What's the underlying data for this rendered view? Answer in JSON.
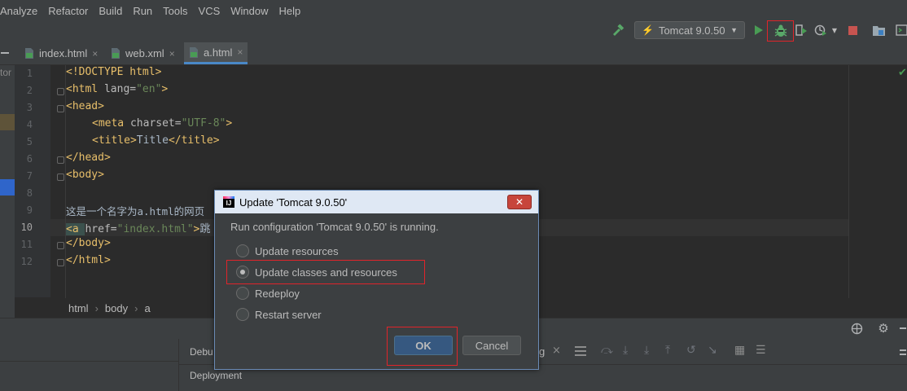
{
  "menu": [
    "Analyze",
    "Refactor",
    "Build",
    "Run",
    "Tools",
    "VCS",
    "Window",
    "Help"
  ],
  "toolbar": {
    "run_config": "Tomcat 9.0.50"
  },
  "tabs": [
    {
      "label": "index.html",
      "close": "×"
    },
    {
      "label": "web.xml",
      "close": "×"
    },
    {
      "label": "a.html",
      "close": "×"
    }
  ],
  "left_partial": "tor",
  "line_numbers": [
    "1",
    "2",
    "3",
    "4",
    "5",
    "6",
    "7",
    "8",
    "9",
    "10",
    "11",
    "12"
  ],
  "code": {
    "l1": "<!DOCTYPE html>",
    "l2_open": "<html ",
    "l2_attr": "lang=",
    "l2_val": "\"en\"",
    "l2_close": ">",
    "l3": "<head>",
    "l4_open": "<meta ",
    "l4_attr": "charset=",
    "l4_val": "\"UTF-8\"",
    "l4_close": ">",
    "l5_open": "<title>",
    "l5_text": "Title",
    "l5_close": "</title>",
    "l6": "</head>",
    "l7": "<body>",
    "l9": "这是一个名字为a.html的网页",
    "l10_open": "<a ",
    "l10_attr": "href=",
    "l10_val": "\"index.html\"",
    "l10_close": ">",
    "l10_text": "跳",
    "l11": "</body>",
    "l12": "</html>"
  },
  "breadcrumb": [
    "html",
    "body",
    "a"
  ],
  "bottom": {
    "debug_label": "Debu",
    "deployment": "Deployment",
    "partial_g": "g"
  },
  "dialog": {
    "title": "Update 'Tomcat 9.0.50'",
    "close": "✕",
    "message": "Run configuration 'Tomcat 9.0.50' is running.",
    "options": [
      {
        "label": "Update resources",
        "selected": false
      },
      {
        "label": "Update classes and resources",
        "selected": true
      },
      {
        "label": "Redeploy",
        "selected": false
      },
      {
        "label": "Restart server",
        "selected": false
      }
    ],
    "ok": "OK",
    "cancel": "Cancel"
  },
  "colors": {
    "highlight": "#e0242a",
    "accent": "#365880",
    "run_green": "#499c54",
    "stop_red": "#c75450"
  }
}
